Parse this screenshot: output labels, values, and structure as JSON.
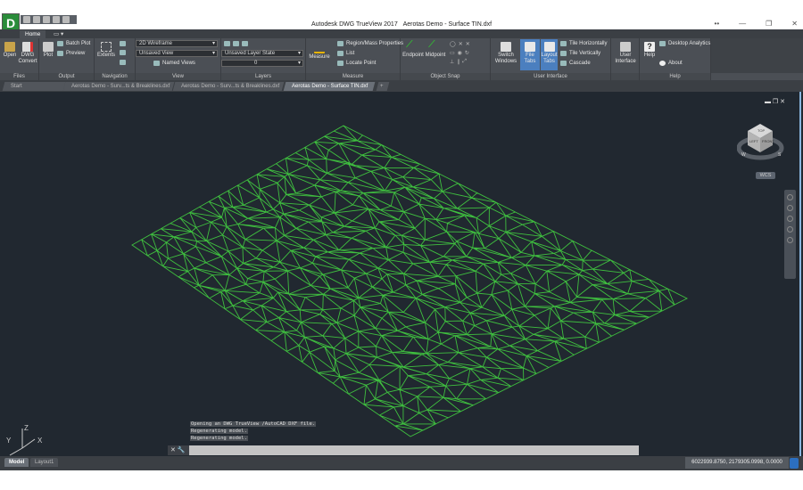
{
  "window": {
    "app_title": "Autodesk DWG TrueView 2017",
    "doc_title": "Aerotas Demo - Surface TIN.dxf",
    "logo": "D",
    "controls": [
      "••",
      "—",
      "❐",
      "✕"
    ]
  },
  "ribbon_tabs": {
    "home": "Home",
    "extra": "▭ ▾"
  },
  "panels": {
    "files": {
      "title": "Files",
      "open": "Open",
      "dwg_convert": "DWG Convert"
    },
    "output": {
      "title": "Output",
      "plot": "Plot",
      "batch_plot": "Batch Plot",
      "preview": "Preview"
    },
    "navigation": {
      "title": "Navigation",
      "extents": "Extents"
    },
    "view": {
      "title": "View",
      "visual_style": "2D Wireframe",
      "saved_view": "Unsaved View",
      "named_views": "Named Views"
    },
    "layers": {
      "title": "Layers",
      "layer_state": "Unsaved Layer State",
      "current_layer": "0"
    },
    "measure": {
      "title": "Measure",
      "measure": "Measure",
      "region_mass": "Region/Mass Properties",
      "list": "List",
      "locate_point": "Locate Point"
    },
    "object_snap": {
      "title": "Object Snap",
      "endpoint": "Endpoint",
      "midpoint": "Midpoint"
    },
    "user_interface": {
      "title": "User Interface",
      "switch_windows": "Switch Windows",
      "file_tabs": "File Tabs",
      "layout_tabs": "Layout Tabs",
      "tile_h": "Tile Horizontally",
      "tile_v": "Tile Vertically",
      "cascade": "Cascade",
      "user_interface": "User Interface"
    },
    "help": {
      "title": "Help",
      "help": "Help",
      "desktop_analytics": "Desktop Analytics",
      "about": "About"
    }
  },
  "file_tabs": [
    "Start",
    "Aerotas Demo - Surv...ts & Breaklines.dxf",
    "Aerotas Demo - Surv...ts & Breaklines.dxf",
    "Aerotas Demo - Surface TIN.dxf"
  ],
  "viewport": {
    "controls": "▬ ❐ ✕",
    "viewcube": {
      "top": "TOP",
      "left": "LEFT",
      "front": "FRONT",
      "n": "N",
      "w": "W",
      "s": "S",
      "e": "E"
    },
    "wcs": "WCS",
    "ucs": {
      "x": "X",
      "y": "Y",
      "z": "Z"
    },
    "mesh_color": "#3fbf3f"
  },
  "command": {
    "history": [
      "Opening an DWG TrueView /AutoCAD  DXF file.",
      "Regenerating model.",
      " Regenerating model."
    ],
    "input_value": "",
    "buttons": "✕ 🔧"
  },
  "status": {
    "tabs": [
      "Model",
      "Layout1"
    ],
    "coordinates": "6022939.8750, 2179305.0998, 0.0000"
  }
}
